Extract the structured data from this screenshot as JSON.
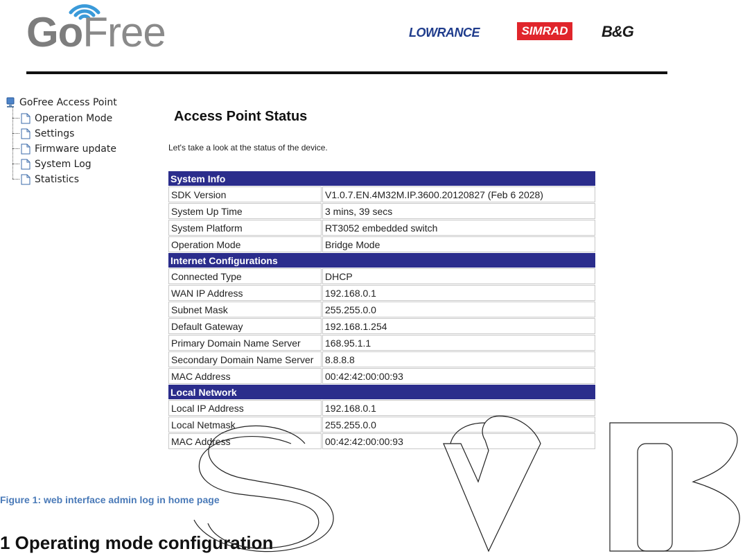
{
  "header": {
    "logo": {
      "go": "Go",
      "free": "Free"
    },
    "brands": {
      "lowrance": "LOWRANCE",
      "simrad": "SIMRAD",
      "bg": "B&G"
    }
  },
  "nav": {
    "root": "GoFree Access Point",
    "items": [
      "Operation Mode",
      "Settings",
      "Firmware update",
      "System Log",
      "Statistics"
    ]
  },
  "main": {
    "title": "Access Point Status",
    "intro": "Let's take a look at the status of the device.",
    "sections": [
      {
        "title": "System Info",
        "rows": [
          [
            "SDK Version",
            "V1.0.7.EN.4M32M.IP.3600.20120827 (Feb 6 2028)"
          ],
          [
            "System Up Time",
            "3 mins, 39 secs"
          ],
          [
            "System Platform",
            "RT3052 embedded switch"
          ],
          [
            "Operation Mode",
            "Bridge Mode"
          ]
        ]
      },
      {
        "title": "Internet Configurations",
        "rows": [
          [
            "Connected Type",
            "DHCP"
          ],
          [
            "WAN IP Address",
            "192.168.0.1"
          ],
          [
            "Subnet Mask",
            "255.255.0.0"
          ],
          [
            "Default Gateway",
            "192.168.1.254"
          ],
          [
            "Primary Domain Name Server",
            "168.95.1.1"
          ],
          [
            "Secondary Domain Name Server",
            "8.8.8.8"
          ],
          [
            "MAC Address",
            "00:42:42:00:00:93"
          ]
        ]
      },
      {
        "title": "Local Network",
        "rows": [
          [
            "Local IP Address",
            "192.168.0.1"
          ],
          [
            "Local Netmask",
            "255.255.0.0"
          ],
          [
            "MAC Address",
            "00:42:42:00:00:93"
          ]
        ]
      }
    ]
  },
  "document": {
    "caption": "Figure 1: web interface admin log in home page",
    "heading": "1   Operating mode configuration"
  },
  "watermark_text": "SVB",
  "colors": {
    "section_header": "#2b2d8c",
    "caption": "#4a7ab8",
    "wifi": "#3a9ad9",
    "simrad": "#e0252b",
    "lowrance": "#1f3c8c"
  }
}
